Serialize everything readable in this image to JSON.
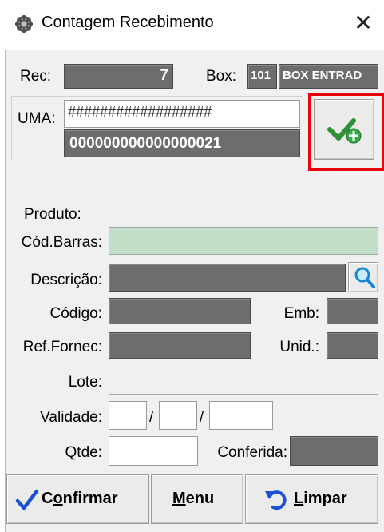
{
  "window": {
    "title": "Contagem Recebimento",
    "close_glyph": "✕"
  },
  "rec": {
    "label": "Rec:",
    "value": "7"
  },
  "box": {
    "label": "Box:",
    "code": "101",
    "name": "BOX ENTRAD"
  },
  "uma": {
    "label": "UMA:",
    "mask": "##################",
    "value": "000000000000000021"
  },
  "confirm_uma_icon": "check-plus-icon",
  "produto": {
    "group_label": "Produto:",
    "cod_barras_label": "Cód.Barras:",
    "cod_barras_value": "",
    "descricao_label": "Descrição:",
    "codigo_label": "Código:",
    "emb_label": "Emb:",
    "ref_fornec_label": "Ref.Fornec:",
    "unid_label": "Unid.:",
    "lote_label": "Lote:",
    "validade_label": "Validade:",
    "date_sep": "/",
    "qtde_label": "Qtde:",
    "conferida_label": "Conferida:"
  },
  "buttons": {
    "confirmar": {
      "first": "C",
      "ul": "o",
      "rest": "nfirmar"
    },
    "menu": {
      "ul": "M",
      "rest": "enu"
    },
    "limpar": {
      "ul": "L",
      "rest": "impar"
    }
  },
  "colors": {
    "highlight": "#e8000b",
    "barcode_bg": "#c2dec8",
    "dark_field": "#6d6d6d"
  }
}
